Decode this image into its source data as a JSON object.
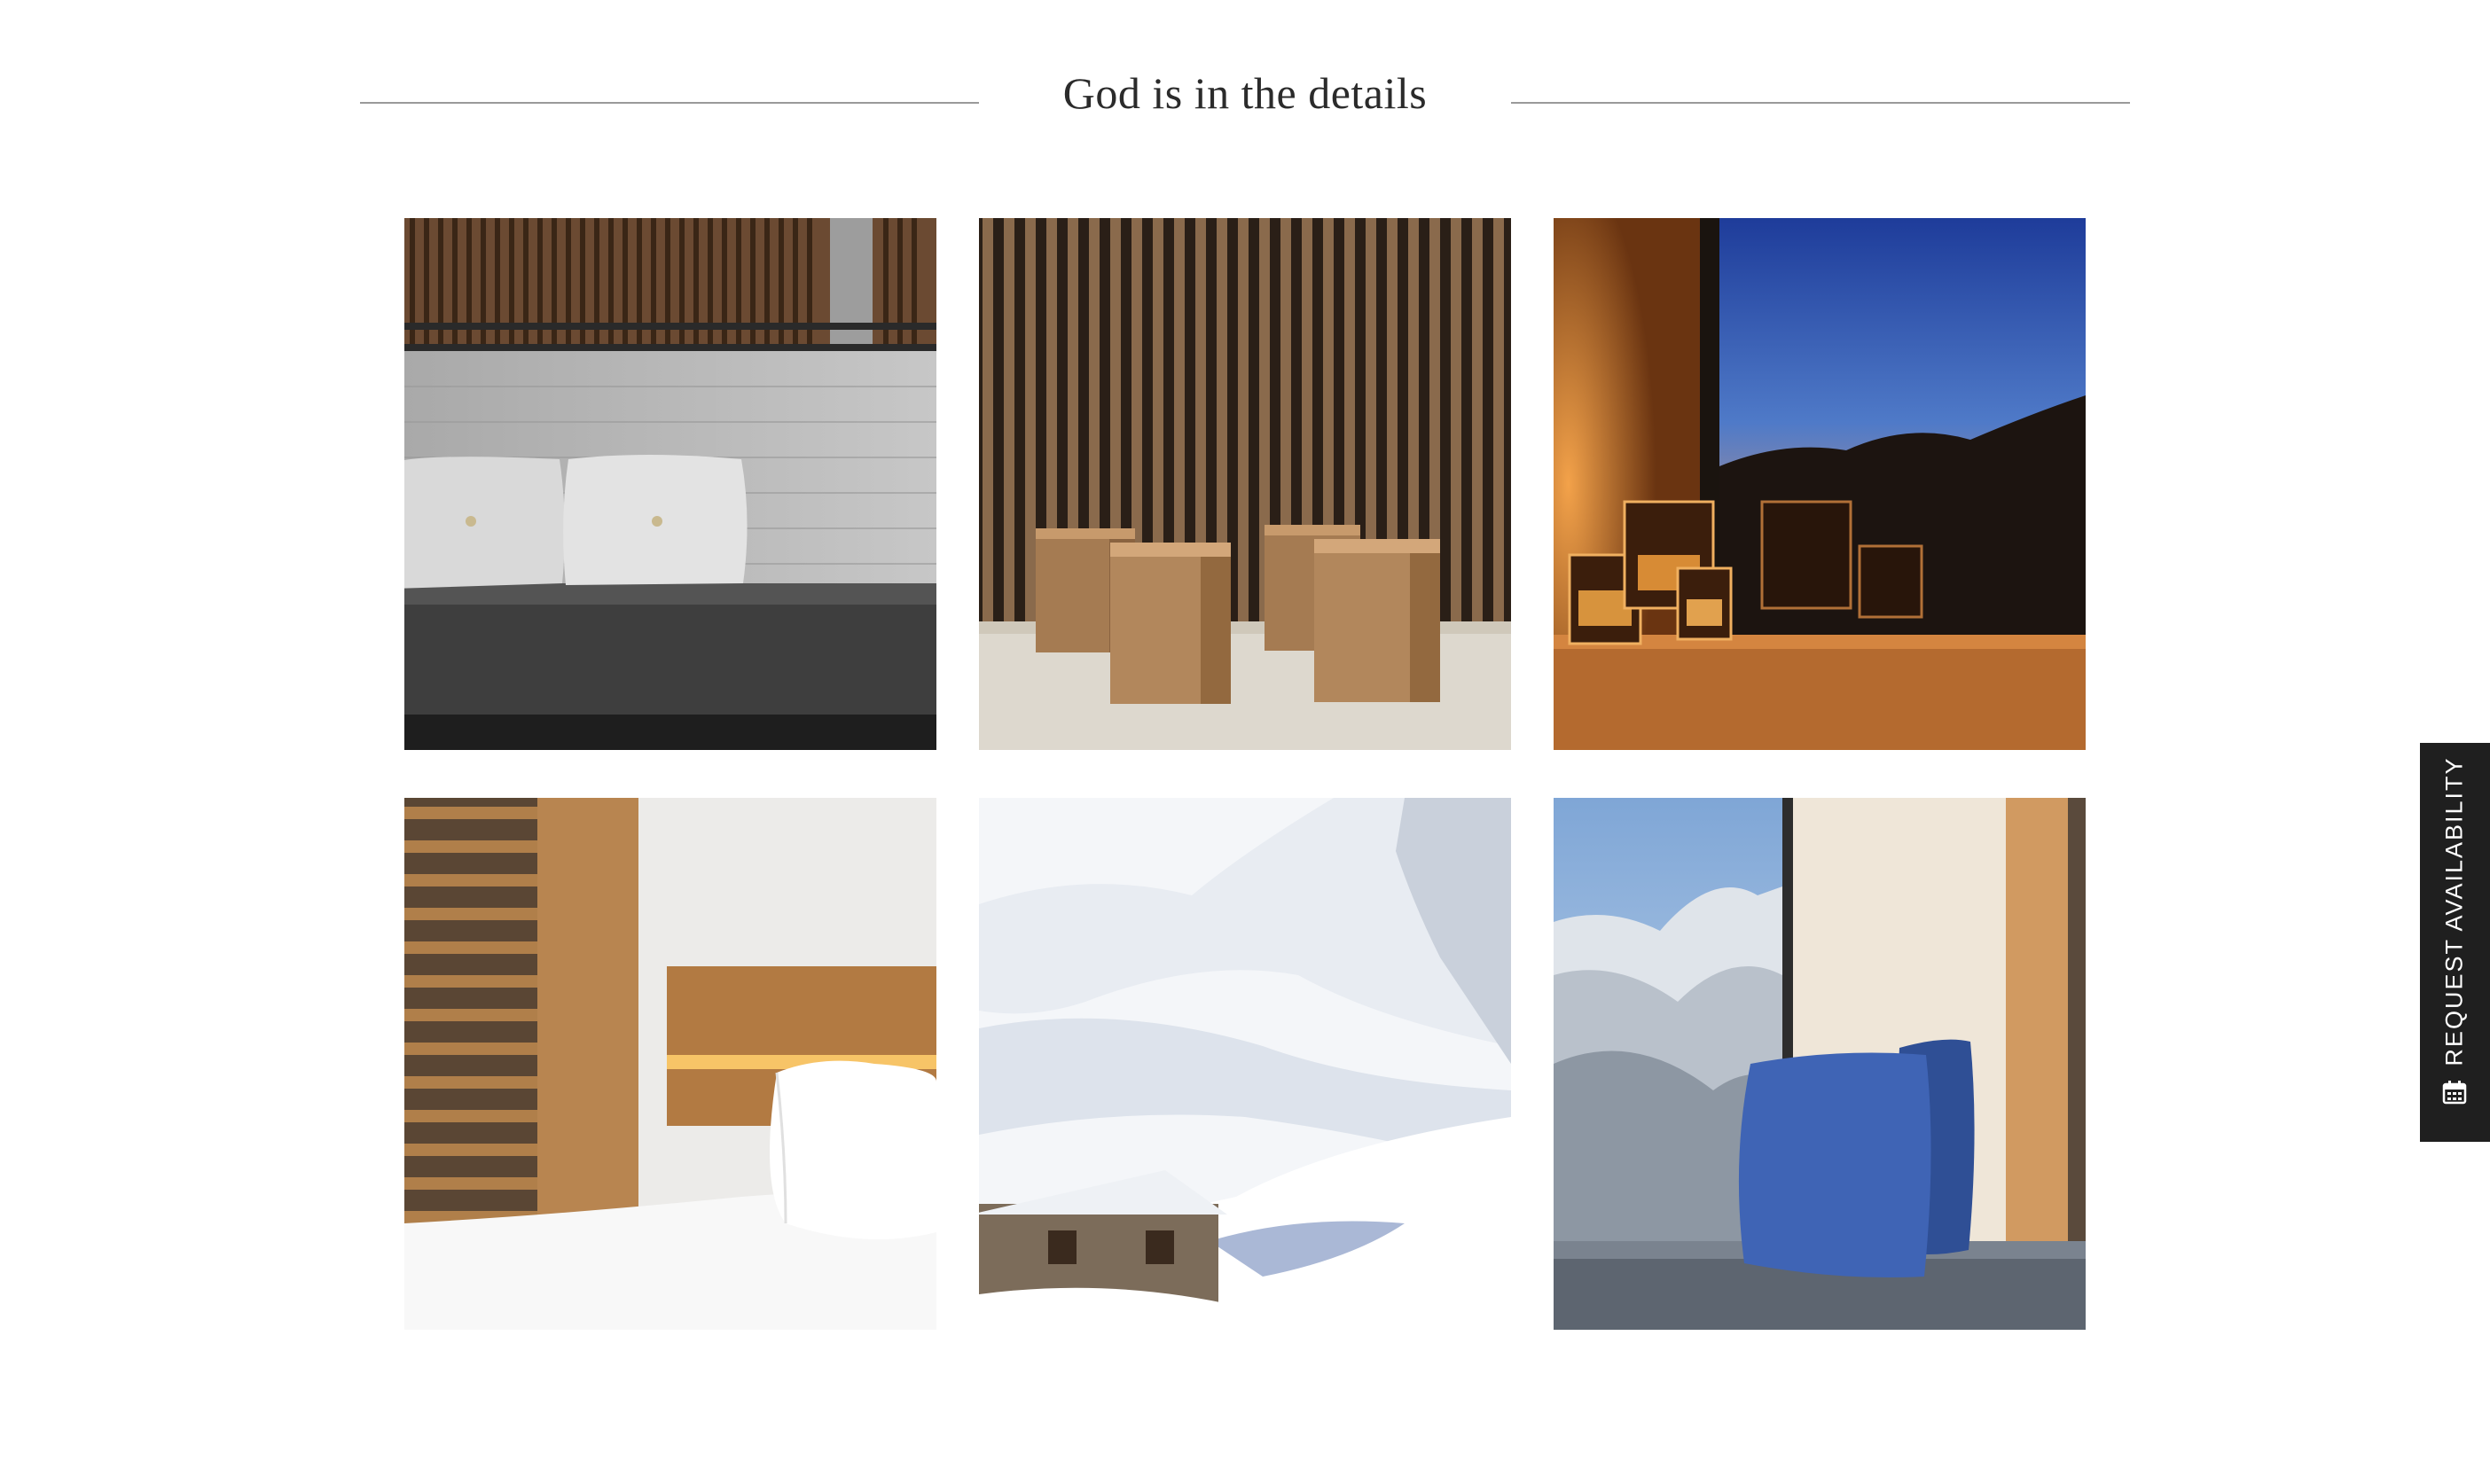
{
  "section": {
    "title": "God is in the details"
  },
  "gallery": {
    "images": [
      {
        "subject": "grey-sofa-with-cushions"
      },
      {
        "subject": "wooden-stools-slatted-wall"
      },
      {
        "subject": "candle-lanterns-window-dusk"
      },
      {
        "subject": "bed-with-wooden-headboard"
      },
      {
        "subject": "snowy-mountain-hut"
      },
      {
        "subject": "window-seat-blue-cushions"
      }
    ]
  },
  "side_tab": {
    "label": "REQUEST AVAILABILITY",
    "icon": "calendar-icon"
  },
  "colors": {
    "title_text": "#2b2b2b",
    "rule": "#9a9a9a",
    "side_tab_bg": "#1f1f1f",
    "side_tab_text": "#ffffff"
  }
}
